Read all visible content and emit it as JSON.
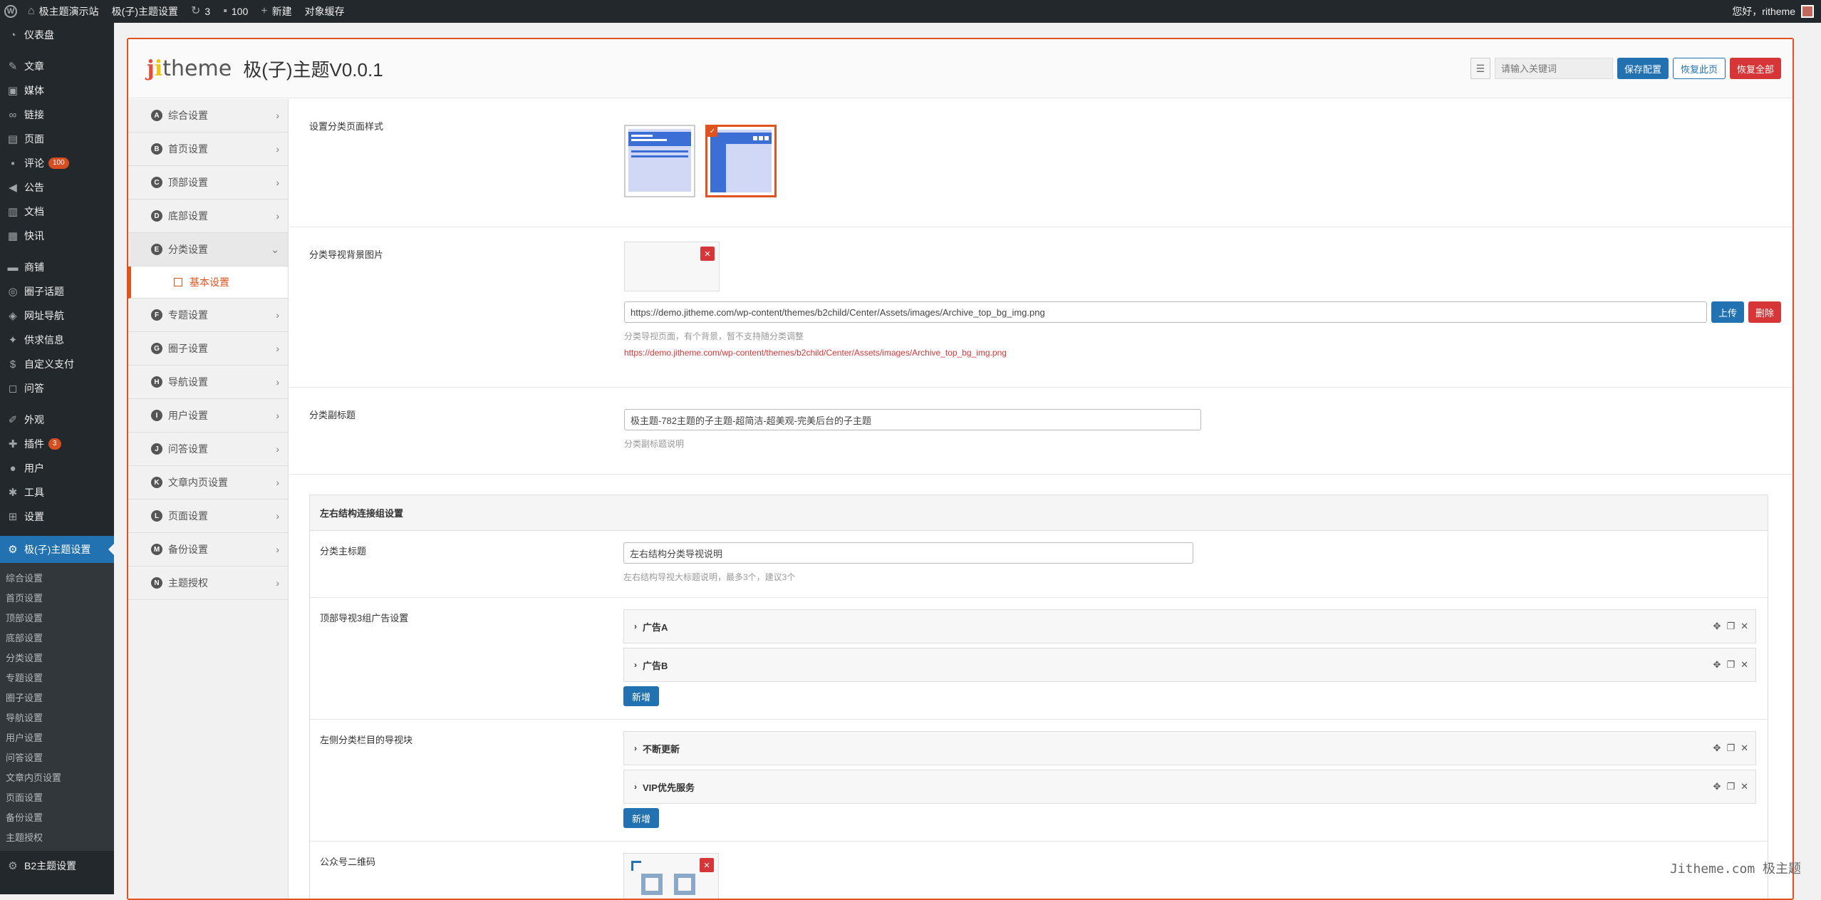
{
  "adminbar": {
    "site_name": "极主题演示站",
    "theme_settings": "极(子)主题设置",
    "updates": "3",
    "comments": "100",
    "new": "新建",
    "cache": "对象缓存",
    "greeting": "您好，ritheme"
  },
  "sidebar": {
    "items": [
      {
        "label": "仪表盘",
        "icon": "dashboard-icon"
      },
      {
        "label": "文章",
        "icon": "pin-icon"
      },
      {
        "label": "媒体",
        "icon": "media-icon"
      },
      {
        "label": "链接",
        "icon": "link-icon"
      },
      {
        "label": "页面",
        "icon": "page-icon"
      },
      {
        "label": "评论",
        "icon": "comment-icon",
        "badge": "100"
      },
      {
        "label": "公告",
        "icon": "megaphone-icon"
      },
      {
        "label": "文档",
        "icon": "document-icon"
      },
      {
        "label": "快讯",
        "icon": "news-icon"
      },
      {
        "label": "商铺",
        "icon": "shop-icon"
      },
      {
        "label": "圈子话题",
        "icon": "circle-icon"
      },
      {
        "label": "网址导航",
        "icon": "nav-icon"
      },
      {
        "label": "供求信息",
        "icon": "supply-icon"
      },
      {
        "label": "自定义支付",
        "icon": "pay-icon"
      },
      {
        "label": "问答",
        "icon": "qa-icon"
      },
      {
        "label": "外观",
        "icon": "brush-icon"
      },
      {
        "label": "插件",
        "icon": "plugin-icon",
        "badge": "3"
      },
      {
        "label": "用户",
        "icon": "user-icon"
      },
      {
        "label": "工具",
        "icon": "tools-icon"
      },
      {
        "label": "设置",
        "icon": "settings-icon"
      }
    ],
    "active": {
      "label": "极(子)主题设置",
      "icon": "gear-icon"
    },
    "subitems": [
      "综合设置",
      "首页设置",
      "顶部设置",
      "底部设置",
      "分类设置",
      "专题设置",
      "圈子设置",
      "导航设置",
      "用户设置",
      "问答设置",
      "文章内页设置",
      "页面设置",
      "备份设置",
      "主题授权"
    ],
    "bottom": {
      "label": "B2主题设置",
      "icon": "gear-icon"
    }
  },
  "header": {
    "logo_j": "j",
    "logo_i": "i",
    "logo_theme": "theme",
    "title": "极(子)主题V0.0.1",
    "search_placeholder": "请输入关键词",
    "save": "保存配置",
    "reset_page": "恢复此页",
    "reset_all": "恢复全部"
  },
  "nav": {
    "items": [
      {
        "letter": "A",
        "label": "综合设置"
      },
      {
        "letter": "B",
        "label": "首页设置"
      },
      {
        "letter": "C",
        "label": "顶部设置"
      },
      {
        "letter": "D",
        "label": "底部设置"
      },
      {
        "letter": "E",
        "label": "分类设置",
        "open": true,
        "sub": "基本设置"
      },
      {
        "letter": "F",
        "label": "专题设置"
      },
      {
        "letter": "G",
        "label": "圈子设置"
      },
      {
        "letter": "H",
        "label": "导航设置"
      },
      {
        "letter": "I",
        "label": "用户设置"
      },
      {
        "letter": "J",
        "label": "问答设置"
      },
      {
        "letter": "K",
        "label": "文章内页设置"
      },
      {
        "letter": "L",
        "label": "页面设置"
      },
      {
        "letter": "M",
        "label": "备份设置"
      },
      {
        "letter": "N",
        "label": "主题授权"
      }
    ]
  },
  "content": {
    "style_label": "设置分类页面样式",
    "bg_label": "分类导视背景图片",
    "bg_url": "https://demo.jitheme.com/wp-content/themes/b2child/Center/Assets/images/Archive_top_bg_img.png",
    "upload": "上传",
    "delete": "删除",
    "bg_desc": "分类导视页面，有个背景，暂不支持随分类调整",
    "bg_url_red": "https://demo.jitheme.com/wp-content/themes/b2child/Center/Assets/images/Archive_top_bg_img.png",
    "subtitle_label": "分类副标题",
    "subtitle_value": "极主题-782主题的子主题-超简洁-超美观-完美后台的子主题",
    "subtitle_desc": "分类副标题说明",
    "group_title": "左右结构连接组设置",
    "main_title_label": "分类主标题",
    "main_title_value": "左右结构分类导视说明",
    "main_title_desc": "左右结构导视大标题说明，最多3个，建议3个",
    "ads_label": "顶部导视3组广告设置",
    "ads": [
      "广告A",
      "广告B"
    ],
    "add": "新增",
    "left_nav_label": "左侧分类栏目的导视块",
    "left_nav": [
      "不断更新",
      "VIP优先服务"
    ],
    "qr_label": "公众号二维码"
  },
  "watermark": "Jitheme.com 极主题"
}
